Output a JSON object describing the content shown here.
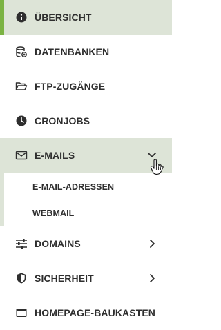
{
  "menu": {
    "items": [
      {
        "label": "ÜBERSICHT",
        "icon": "info-icon"
      },
      {
        "label": "DATENBANKEN",
        "icon": "database-icon"
      },
      {
        "label": "FTP-ZUGÄNGE",
        "icon": "folder-open-icon"
      },
      {
        "label": "CRONJOBS",
        "icon": "clock-icon"
      },
      {
        "label": "E-MAILS",
        "icon": "envelope-icon"
      },
      {
        "label": "DOMAINS",
        "icon": "sliders-icon"
      },
      {
        "label": "SICHERHEIT",
        "icon": "shield-icon"
      },
      {
        "label": "HOMEPAGE-BAUKASTEN",
        "icon": "window-icon"
      }
    ],
    "email_submenu": [
      {
        "label": "E-MAIL-ADRESSEN"
      },
      {
        "label": "WEBMAIL"
      }
    ]
  },
  "colors": {
    "active_bg": "#dde4d7",
    "active_accent": "#7bb342",
    "text": "#2e2e2e"
  }
}
